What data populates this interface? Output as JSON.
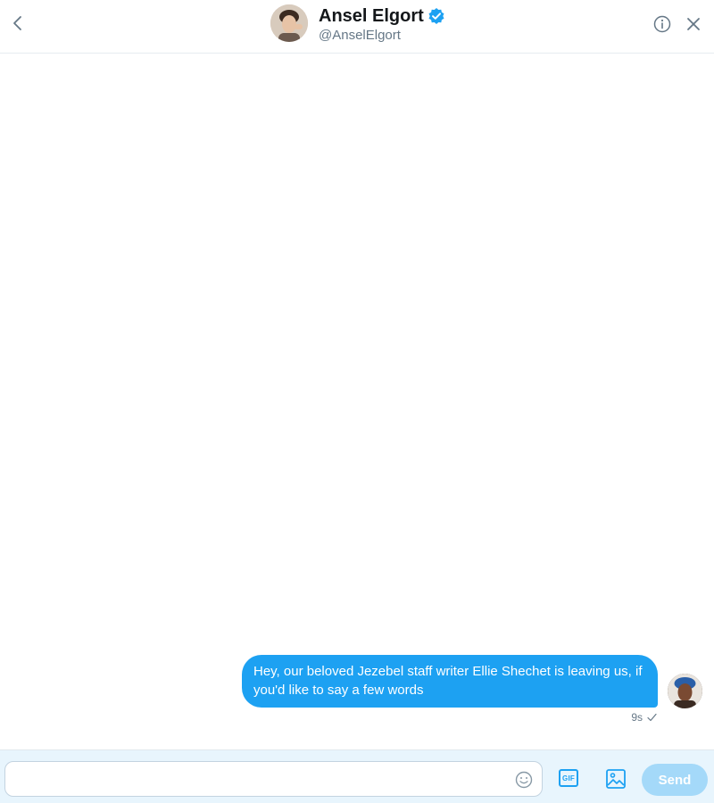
{
  "header": {
    "name": "Ansel Elgort",
    "handle": "@AnselElgort",
    "verified": true
  },
  "messages": [
    {
      "text": "Hey, our beloved Jezebel staff writer Ellie Shechet is leaving us, if you'd like to say a few words",
      "time": "9s",
      "status": "sent-check"
    }
  ],
  "composer": {
    "value": "",
    "placeholder": "",
    "gif_label": "GIF",
    "send_label": "Send"
  },
  "icons": {
    "back": "chevron-left-icon",
    "verified": "verified-badge-icon",
    "info": "info-icon",
    "close": "close-icon",
    "emoji": "emoji-icon",
    "gif": "gif-icon",
    "image": "image-icon",
    "check": "check-icon"
  },
  "colors": {
    "accent": "#1da1f2",
    "send_disabled": "#a4d9f9",
    "composer_bg": "#e8f5fd",
    "muted_text": "#657786"
  }
}
